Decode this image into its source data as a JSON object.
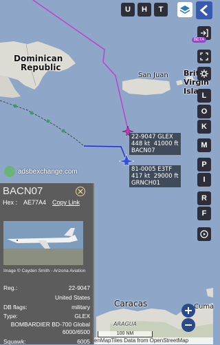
{
  "map": {
    "labels": {
      "dominican": "Dominican",
      "republic": "Republic",
      "san_juan": "San Juan",
      "bvi_1": "Briti",
      "bvi_2": "Virgin",
      "bvi_3": "Islan",
      "caracas": "Caracas",
      "cumana": "Cuma",
      "aragua": "ARAGUA"
    },
    "watermark": "adsbexchange.com",
    "scale": "100 NM",
    "attribution": "enMapTiles Data from OpenStreetMap"
  },
  "toolbar": {
    "u": "U",
    "h": "H",
    "t": "T",
    "back_icon": "chevron-left-icon",
    "layers_icon": "layers-icon"
  },
  "sidebar": {
    "beta": "BETA",
    "buttons": [
      "L",
      "O",
      "K",
      "M",
      "P",
      "I",
      "R",
      "F"
    ]
  },
  "aircraft": [
    {
      "line1": "22-9047 GLEX",
      "line2": "448 kt  41000 ft",
      "line3": "BACN07"
    },
    {
      "line1": "81-0005 E3TF",
      "line2": "417 kt  29000 ft",
      "line3": "GRNCH01"
    }
  ],
  "panel": {
    "callsign": "BACN07",
    "hex_label": "Hex :",
    "hex_value": "AE77A4",
    "copy_link": "Copy Link",
    "photo_credit": "Image © Cayden Smith - Arizona Aviation",
    "rows": [
      {
        "k": "Reg.:",
        "v": "22-9047"
      },
      {
        "k": "",
        "v": "United States"
      },
      {
        "k": "DB flags:",
        "v": "military"
      },
      {
        "k": "Type:",
        "v": "GLEX"
      },
      {
        "k": "",
        "v": "BOMBARDIER BD-700 Global"
      },
      {
        "k": "",
        "v": "6000/6500"
      },
      {
        "k": "Squawk:",
        "v": "6005"
      }
    ]
  },
  "colors": {
    "water": "#8ea6c8",
    "land": "#dcdcd4",
    "track1": "#c040d0",
    "track2": "#2030d0",
    "panel": "#5c5c5c"
  }
}
